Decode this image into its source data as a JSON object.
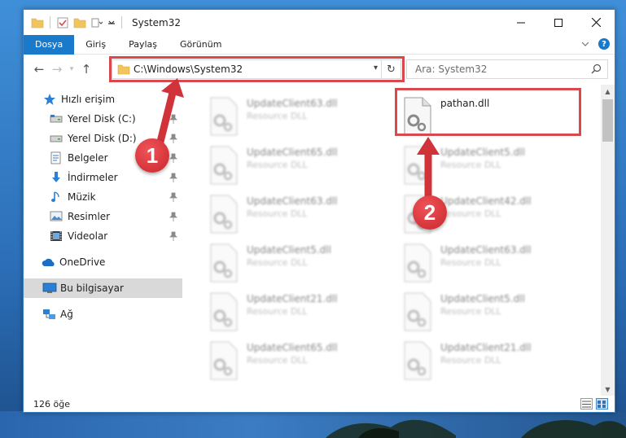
{
  "window": {
    "title": "System32"
  },
  "ribbon": {
    "tabs": [
      {
        "label": "Dosya",
        "active": true
      },
      {
        "label": "Giriş",
        "active": false
      },
      {
        "label": "Paylaş",
        "active": false
      },
      {
        "label": "Görünüm",
        "active": false
      }
    ],
    "help_label": "?"
  },
  "navigation": {
    "address": "C:\\Windows\\System32",
    "search_placeholder": "Ara: System32"
  },
  "sidebar": {
    "quick_access": "Hızlı erişim",
    "items": [
      {
        "label": "Yerel Disk (C:)",
        "icon": "drive-icon",
        "pinned": true
      },
      {
        "label": "Yerel Disk (D:)",
        "icon": "drive-icon",
        "pinned": true
      },
      {
        "label": "Belgeler",
        "icon": "documents-icon",
        "pinned": true
      },
      {
        "label": "İndirmeler",
        "icon": "download-icon",
        "pinned": true
      },
      {
        "label": "Müzik",
        "icon": "music-icon",
        "pinned": true
      },
      {
        "label": "Resimler",
        "icon": "pictures-icon",
        "pinned": true
      },
      {
        "label": "Videolar",
        "icon": "video-icon",
        "pinned": true
      }
    ],
    "onedrive": "OneDrive",
    "this_pc": "Bu bilgisayar",
    "network": "Ağ"
  },
  "files": {
    "col1": [
      {
        "name": "UpdateClient63.dll",
        "type": "Resource DLL"
      },
      {
        "name": "UpdateClient65.dll",
        "type": "Resource DLL"
      },
      {
        "name": "UpdateClient63.dll",
        "type": "Resource DLL"
      },
      {
        "name": "UpdateClient5.dll",
        "type": "Resource DLL"
      },
      {
        "name": "UpdateClient21.dll",
        "type": "Resource DLL"
      },
      {
        "name": "UpdateClient65.dll",
        "type": "Resource DLL"
      }
    ],
    "highlighted": {
      "name": "pathan.dll"
    },
    "col2": [
      {
        "name": "UpdateClient5.dll",
        "type": "Resource DLL"
      },
      {
        "name": "UpdateClient42.dll",
        "type": "Resource DLL"
      },
      {
        "name": "UpdateClient63.dll",
        "type": "Resource DLL"
      },
      {
        "name": "UpdateClient5.dll",
        "type": "Resource DLL"
      },
      {
        "name": "UpdateClient21.dll",
        "type": "Resource DLL"
      }
    ]
  },
  "status": {
    "item_count": "126 öğe"
  },
  "callouts": {
    "one": "1",
    "two": "2"
  },
  "colors": {
    "accent": "#1979ca",
    "highlight_box": "#d9484c",
    "callout": "#d0333a"
  }
}
